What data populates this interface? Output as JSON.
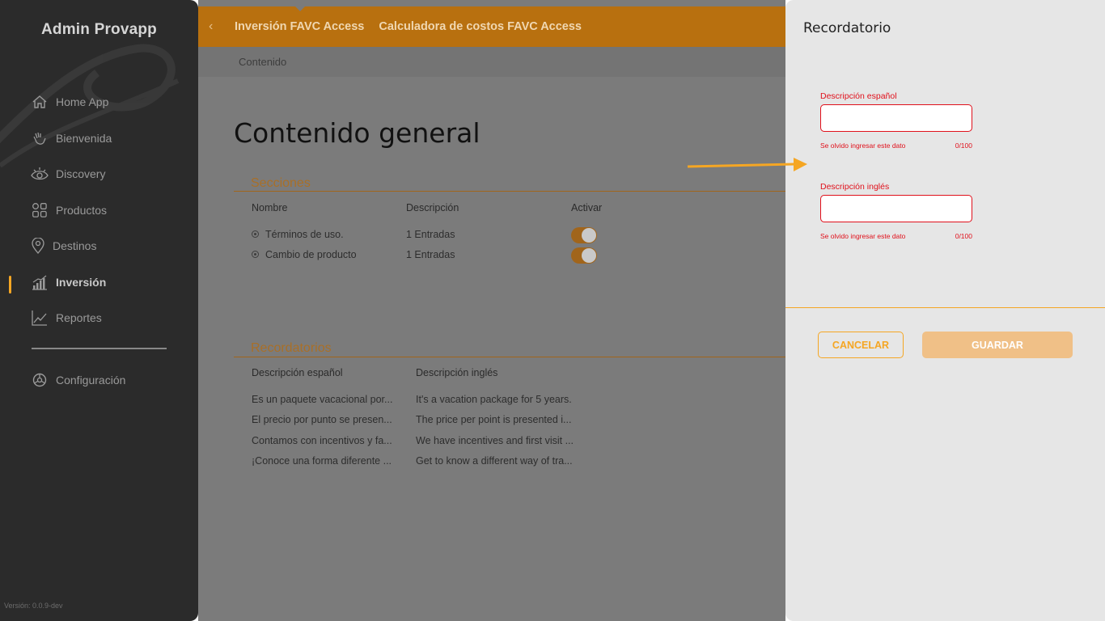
{
  "sidebar": {
    "brand": "Admin Provapp",
    "items": [
      {
        "label": "Home App",
        "icon": "home-icon"
      },
      {
        "label": "Bienvenida",
        "icon": "wave-hand-icon"
      },
      {
        "label": "Discovery",
        "icon": "eye-icon"
      },
      {
        "label": "Productos",
        "icon": "grid-icon"
      },
      {
        "label": "Destinos",
        "icon": "location-pin-icon"
      },
      {
        "label": "Inversión",
        "icon": "bar-chart-icon"
      },
      {
        "label": "Reportes",
        "icon": "line-chart-icon"
      },
      {
        "label": "Configuración",
        "icon": "settings-icon"
      }
    ],
    "version": "Versión: 0.0.9-dev"
  },
  "header": {
    "tabs": [
      "Inversión FAVC Access",
      "Calculadora de costos FAVC Access"
    ],
    "breadcrumb": "Contenido"
  },
  "main": {
    "title": "Contenido general",
    "secciones": {
      "title": "Secciones",
      "headers": [
        "Nombre",
        "Descripción",
        "Activar"
      ],
      "rows": [
        {
          "nombre": "Términos de uso.",
          "descripcion": "1 Entradas",
          "activo": true
        },
        {
          "nombre": "Cambio de producto",
          "descripcion": "1 Entradas",
          "activo": true
        }
      ]
    },
    "recordatorios": {
      "title": "Recordatorios",
      "headers": [
        "Descripción español",
        "Descripción inglés"
      ],
      "rows": [
        {
          "es": "Es un paquete vacacional por...",
          "en": "It's a vacation package for 5 years."
        },
        {
          "es": "El precio por punto se presen...",
          "en": "The price per point is presented i..."
        },
        {
          "es": "Contamos con incentivos y fa...",
          "en": "We have incentives and first visit ..."
        },
        {
          "es": "¡Conoce una forma diferente ...",
          "en": "Get to know a different way of tra..."
        }
      ]
    }
  },
  "drawer": {
    "title": "Recordatorio",
    "field_es": {
      "label": "Descripción español",
      "value": "",
      "error": "Se olvido ingresar este dato",
      "count": "0/100"
    },
    "field_en": {
      "label": "Descripción inglés",
      "value": "",
      "error": "Se olvido ingresar este dato",
      "count": "0/100"
    },
    "cancel_label": "CANCELAR",
    "save_label": "GUARDAR"
  },
  "colors": {
    "accent": "#f5a623",
    "error": "#e0101b",
    "sidebar_bg": "#2b2b2b",
    "drawer_bg": "#e6e6e6"
  }
}
